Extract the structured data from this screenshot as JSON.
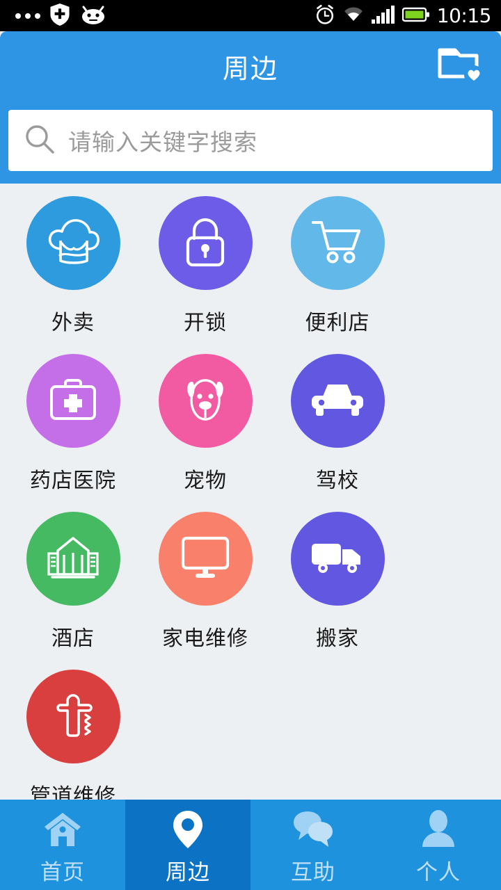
{
  "status_bar": {
    "time": "10:15",
    "left_icons": [
      "more-dots-icon",
      "shield-plus-icon",
      "android-robot-icon"
    ],
    "right_icons": [
      "alarm-clock-icon",
      "wifi-icon",
      "signal-bars-icon",
      "battery-icon"
    ],
    "battery_color": "#7ed321"
  },
  "header": {
    "title": "周边",
    "action_icon": "folder-heart-icon",
    "background": "#2e95e4"
  },
  "search": {
    "placeholder": "请输入关键字搜索",
    "value": "",
    "icon": "search-icon"
  },
  "grid": {
    "items": [
      {
        "label": "外卖",
        "icon": "chef-hat-icon",
        "color": "#2e9bdf"
      },
      {
        "label": "开锁",
        "icon": "padlock-icon",
        "color": "#6c5ce7"
      },
      {
        "label": "便利店",
        "icon": "shopping-cart-icon",
        "color": "#63b8ea"
      },
      {
        "label": "药店医院",
        "icon": "first-aid-kit-icon",
        "color": "#c46ee8"
      },
      {
        "label": "宠物",
        "icon": "dog-face-icon",
        "color": "#f25ba2"
      },
      {
        "label": "驾校",
        "icon": "car-icon",
        "color": "#6257e0"
      },
      {
        "label": "酒店",
        "icon": "hotel-building-icon",
        "color": "#46b963"
      },
      {
        "label": "家电维修",
        "icon": "monitor-icon",
        "color": "#f9806a"
      },
      {
        "label": "搬家",
        "icon": "moving-truck-icon",
        "color": "#6257e0"
      },
      {
        "label": "管道维修",
        "icon": "pipe-faucet-icon",
        "color": "#d93f3f"
      }
    ]
  },
  "tabbar": {
    "background": "#1f92de",
    "active_background": "#0b72c4",
    "tabs": [
      {
        "label": "首页",
        "icon": "home-icon",
        "active": false
      },
      {
        "label": "周边",
        "icon": "map-pin-icon",
        "active": true
      },
      {
        "label": "互助",
        "icon": "chat-bubbles-icon",
        "active": false
      },
      {
        "label": "个人",
        "icon": "user-icon",
        "active": false
      }
    ]
  }
}
